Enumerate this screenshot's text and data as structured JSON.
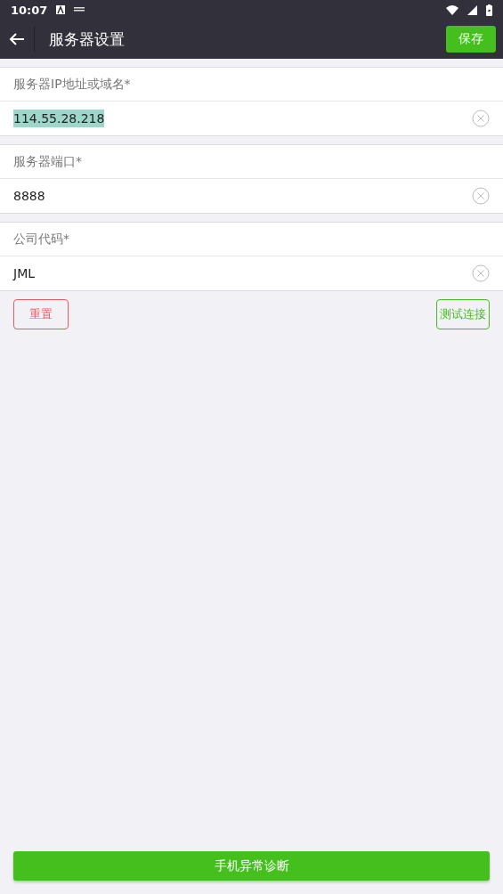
{
  "status_bar": {
    "time": "10:07"
  },
  "app_bar": {
    "title": "服务器设置",
    "action": "保存"
  },
  "fields": [
    {
      "label": "服务器IP地址或域名*",
      "value": "114.55.28.218",
      "highlighted": true
    },
    {
      "label": "服务器端口*",
      "value": "8888",
      "highlighted": false
    },
    {
      "label": "公司代码*",
      "value": "JML",
      "highlighted": false
    }
  ],
  "actions": [
    {
      "label": "重置",
      "kind": "danger"
    },
    {
      "label": "测试连接",
      "kind": "success"
    }
  ],
  "bottom_button": "手机异常诊断"
}
